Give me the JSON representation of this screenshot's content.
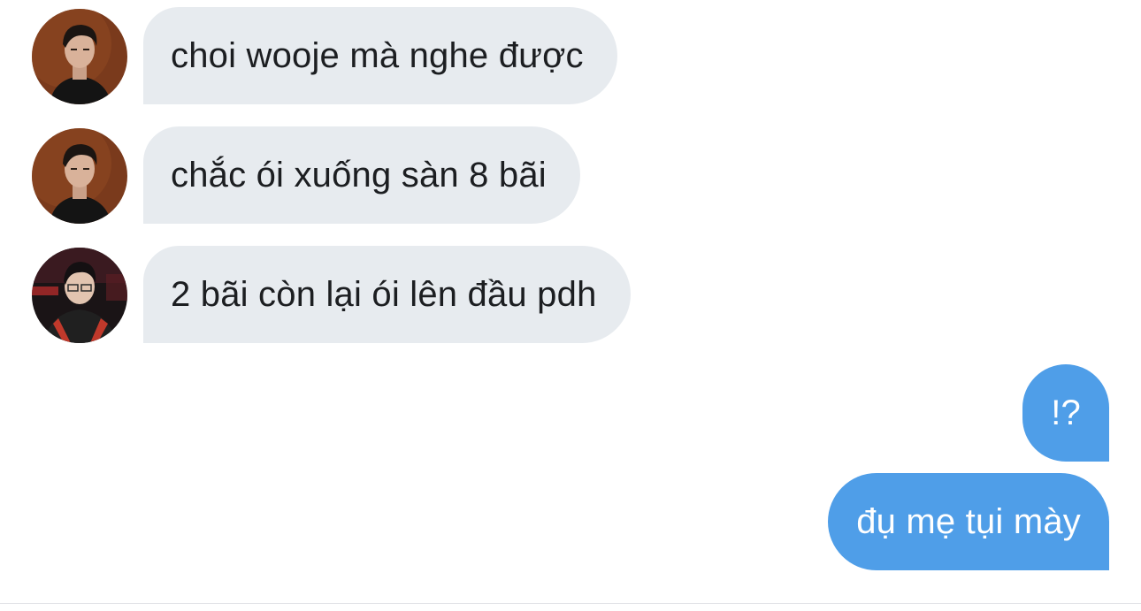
{
  "messages": [
    {
      "direction": "incoming",
      "sender": "user-a",
      "text": "choi wooje mà nghe được"
    },
    {
      "direction": "incoming",
      "sender": "user-a",
      "text": "chắc ói xuống sàn 8 bãi"
    },
    {
      "direction": "incoming",
      "sender": "user-b",
      "text": "2 bãi còn lại ói lên đầu pdh"
    },
    {
      "direction": "outgoing",
      "text": "!?"
    },
    {
      "direction": "outgoing",
      "text": "đụ mẹ tụi mày"
    }
  ],
  "colors": {
    "incoming_bubble": "#e7ebef",
    "incoming_text": "#1c1e21",
    "outgoing_bubble": "#4f9ee8",
    "outgoing_text": "#ffffff"
  }
}
